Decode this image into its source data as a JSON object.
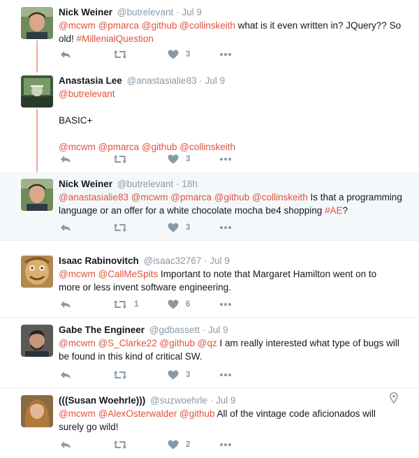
{
  "accent_color": "#e0523e",
  "tweets": [
    {
      "name": "Nick Weiner",
      "handle": "@butrelevant",
      "sep": "·",
      "time": "Jul 9",
      "avatar": "avatar-nick",
      "lines": [
        [
          {
            "t": "@mcwm",
            "l": true
          },
          {
            "t": " "
          },
          {
            "t": "@pmarca",
            "l": true
          },
          {
            "t": " "
          },
          {
            "t": "@github",
            "l": true
          },
          {
            "t": " "
          },
          {
            "t": "@collinskeith",
            "l": true
          },
          {
            "t": " what is it even written in? JQuery?? So"
          }
        ],
        [
          {
            "t": "old! "
          },
          {
            "t": "#MillenialQuestion",
            "l": true
          }
        ]
      ],
      "reply_count": "",
      "retweet_count": "",
      "like_count": "3"
    },
    {
      "name": "Anastasia Lee",
      "handle": "@anastasialie83",
      "sep": "·",
      "time": "Jul 9",
      "avatar": "avatar-anastasia",
      "lines": [
        [
          {
            "t": "@butrelevant",
            "l": true
          }
        ],
        [],
        [
          {
            "t": "BASIC+"
          }
        ],
        [],
        [
          {
            "t": "@mcwm",
            "l": true
          },
          {
            "t": " "
          },
          {
            "t": "@pmarca",
            "l": true
          },
          {
            "t": " "
          },
          {
            "t": "@github",
            "l": true
          },
          {
            "t": " "
          },
          {
            "t": "@collinskeith",
            "l": true
          }
        ]
      ],
      "reply_count": "",
      "retweet_count": "",
      "like_count": "3"
    },
    {
      "name": "Nick Weiner",
      "handle": "@butrelevant",
      "sep": "·",
      "time": "18h",
      "avatar": "avatar-nick",
      "lines": [
        [
          {
            "t": "@anastasialie83",
            "l": true
          },
          {
            "t": " "
          },
          {
            "t": "@mcwm",
            "l": true
          },
          {
            "t": " "
          },
          {
            "t": "@pmarca",
            "l": true
          },
          {
            "t": " "
          },
          {
            "t": "@github",
            "l": true
          },
          {
            "t": " "
          },
          {
            "t": "@collinskeith",
            "l": true
          },
          {
            "t": " Is that a programming"
          }
        ],
        [
          {
            "t": "language or an offer for a white chocolate mocha be4 shopping "
          },
          {
            "t": "#AE",
            "l": true
          },
          {
            "t": "?"
          }
        ]
      ],
      "reply_count": "",
      "retweet_count": "",
      "like_count": "3"
    },
    {
      "name": "Isaac Rabinovitch",
      "handle": "@isaac32767",
      "sep": "·",
      "time": "Jul 9",
      "avatar": "avatar-isaac",
      "lines": [
        [
          {
            "t": "@mcwm",
            "l": true
          },
          {
            "t": " "
          },
          {
            "t": "@CallMeSpits",
            "l": true
          },
          {
            "t": " Important to note that Margaret Hamilton went on to"
          }
        ],
        [
          {
            "t": "more or less invent software engineering."
          }
        ]
      ],
      "reply_count": "",
      "retweet_count": "1",
      "like_count": "6"
    },
    {
      "name": "Gabe The Engineer",
      "handle": "@gdbassett",
      "sep": "·",
      "time": "Jul 9",
      "avatar": "avatar-gabe",
      "lines": [
        [
          {
            "t": "@mcwm",
            "l": true
          },
          {
            "t": " "
          },
          {
            "t": "@S_Clarke22",
            "l": true
          },
          {
            "t": " "
          },
          {
            "t": "@github",
            "l": true
          },
          {
            "t": " "
          },
          {
            "t": "@qz",
            "l": true
          },
          {
            "t": " I am really interested what type of bugs will"
          }
        ],
        [
          {
            "t": "be found in this kind of critical SW."
          }
        ]
      ],
      "reply_count": "",
      "retweet_count": "",
      "like_count": "3"
    },
    {
      "name": "(((Susan Woehrle)))",
      "handle": "@suzwoehrle",
      "sep": "·",
      "time": "Jul 9",
      "avatar": "avatar-susan",
      "lines": [
        [
          {
            "t": "@mcwm",
            "l": true
          },
          {
            "t": " "
          },
          {
            "t": "@AlexOsterwalder",
            "l": true
          },
          {
            "t": " "
          },
          {
            "t": "@github",
            "l": true
          },
          {
            "t": " All of the vintage code aficionados will"
          }
        ],
        [
          {
            "t": "surely go wild!"
          }
        ]
      ],
      "reply_count": "",
      "retweet_count": "",
      "like_count": "2",
      "location_icon": "map-pin-icon"
    }
  ]
}
